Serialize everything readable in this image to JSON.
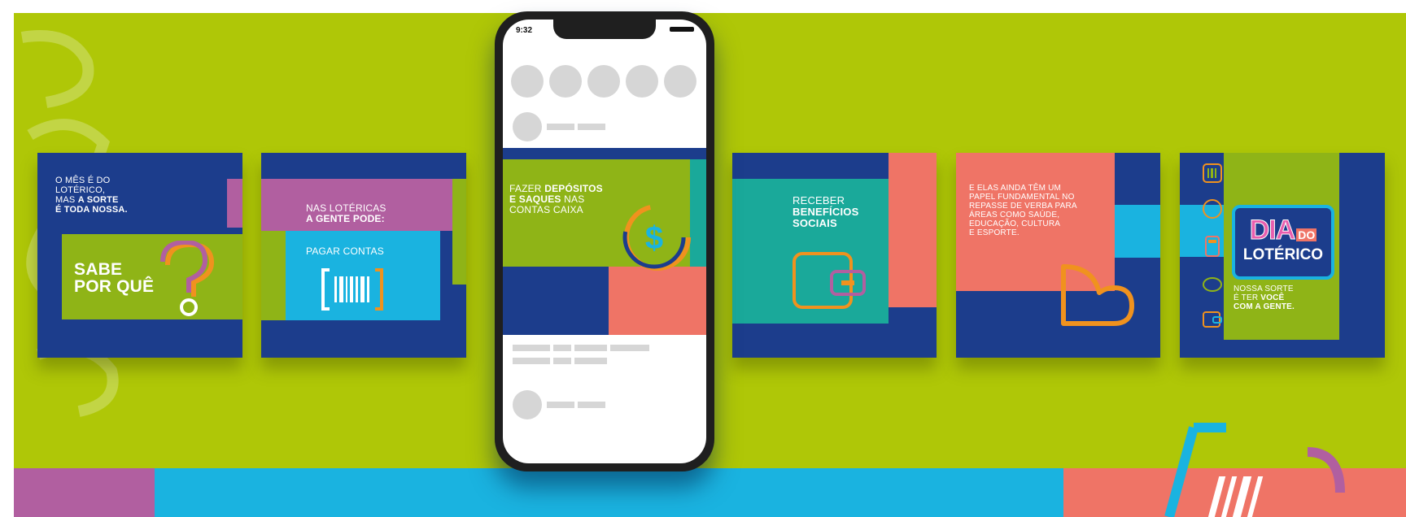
{
  "phone": {
    "status_time": "9:32",
    "post_text": {
      "line1": "FAZER",
      "line1_bold": "DEPÓSITOS",
      "line2_bold": "E SAQUES",
      "line2": "NAS",
      "line3": "CONTAS CAIXA"
    }
  },
  "posts": [
    {
      "line1": "O MÊS É DO",
      "line2": "LOTÉRICO,",
      "line3": "MAS",
      "line3_bold": "A SORTE",
      "line4_bold": "É TODA NOSSA.",
      "big1": "SABE",
      "big2": "POR QUÊ"
    },
    {
      "line1": "NAS LOTÉRICAS",
      "line2_bold": "A GENTE PODE:",
      "sub": "PAGAR CONTAS"
    },
    {
      "line1": "RECEBER",
      "line2_bold": "BENEFÍCIOS",
      "line3_bold": "SOCIAIS"
    },
    {
      "lines": [
        "E ELAS AINDA TÊM UM",
        "PAPEL FUNDAMENTAL NO",
        "REPASSE DE VERBA PARA",
        "ÁREAS COMO SAÚDE,",
        "EDUCAÇÃO, CULTURA",
        "E ESPORTE."
      ]
    },
    {
      "logo1": "DIA",
      "logo2": "DO",
      "logo3": "LOTÉRICO",
      "line1": "NOSSA SORTE",
      "line2": "É TER",
      "line2_bold": "VOCÊ",
      "line3_bold": "COM A GENTE."
    }
  ],
  "colors": {
    "background": "#afc707",
    "navy": "#1c3d8c",
    "pink": "#b15fa0",
    "teal": "#1aa99a",
    "cyan": "#1ab3e0",
    "coral": "#ef7466",
    "orange": "#f0921e"
  }
}
